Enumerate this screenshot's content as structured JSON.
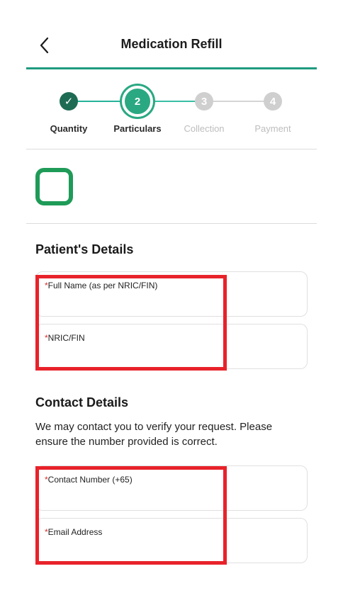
{
  "header": {
    "title": "Medication Refill",
    "back_icon": "chevron-left-icon"
  },
  "stepper": {
    "steps": [
      {
        "label": "Quantity",
        "badge": "✓",
        "state": "done"
      },
      {
        "label": "Particulars",
        "badge": "2",
        "state": "active"
      },
      {
        "label": "Collection",
        "badge": "3",
        "state": "pending"
      },
      {
        "label": "Payment",
        "badge": "4",
        "state": "pending"
      }
    ]
  },
  "colors": {
    "accent": "#1f9a80",
    "checkbox_border": "#1f9b58",
    "required": "#e02b2b",
    "highlight": "#e8222a"
  },
  "patient": {
    "title": "Patient's Details",
    "fields": [
      {
        "label": "Full Name (as per NRIC/FIN)",
        "required_mark": "*",
        "value": "",
        "placeholder": ""
      },
      {
        "label": "NRIC/FIN",
        "required_mark": "*",
        "value": "",
        "placeholder": ""
      }
    ]
  },
  "contact": {
    "title": "Contact Details",
    "description": "We may contact you to verify your request. Please ensure the number provided is correct.",
    "fields": [
      {
        "label": "Contact Number (+65)",
        "required_mark": "*",
        "value": "",
        "placeholder": ""
      },
      {
        "label": "Email Address",
        "required_mark": "*",
        "value": "",
        "placeholder": ""
      }
    ]
  }
}
